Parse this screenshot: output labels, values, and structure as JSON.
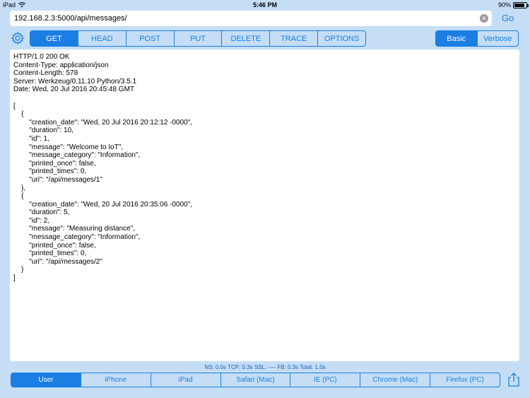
{
  "status_bar": {
    "device": "iPad",
    "time": "5:46 PM",
    "battery": "90%",
    "battery_level": 0.9
  },
  "url_bar": {
    "value": "192.168.2.3:5000/api/messages/",
    "go_label": "Go"
  },
  "methods": [
    "GET",
    "HEAD",
    "POST",
    "PUT",
    "DELETE",
    "TRACE",
    "OPTIONS"
  ],
  "selected_method": "GET",
  "modes": [
    "Basic",
    "Verbose"
  ],
  "selected_mode": "Basic",
  "response": {
    "headers": [
      "HTTP/1.0 200 OK",
      "Content-Type: application/json",
      "Content-Length: 578",
      "Server: Werkzeug/0.11.10 Python/3.5.1",
      "Date: Wed, 20 Jul 2016 20:45:48 GMT"
    ],
    "body_lines": [
      "[",
      "    {",
      "        \"creation_date\": \"Wed, 20 Jul 2016 20:12:12 -0000\",",
      "        \"duration\": 10,",
      "        \"id\": 1,",
      "        \"message\": \"Welcome to IoT\",",
      "        \"message_category\": \"Information\",",
      "        \"printed_once\": false,",
      "        \"printed_times\": 0,",
      "        \"uri\": \"/api/messages/1\"",
      "    },",
      "    {",
      "        \"creation_date\": \"Wed, 20 Jul 2016 20:35:06 -0000\",",
      "        \"duration\": 5,",
      "        \"id\": 2,",
      "        \"message\": \"Measuring distance\",",
      "        \"message_category\": \"Information\",",
      "        \"printed_once\": false,",
      "        \"printed_times\": 0,",
      "        \"uri\": \"/api/messages/2\"",
      "    }",
      "]"
    ]
  },
  "timings": "NS: 0.0s   TCP: 0.3s   SSL: ----   FB: 0.3s   Total: 1.0s",
  "user_agents": [
    "User",
    "iPhone",
    "iPad",
    "Safari (Mac)",
    "IE (PC)",
    "Chrome (Mac)",
    "Firefox (PC)"
  ],
  "selected_user_agent": "User",
  "colors": {
    "accent": "#1a7ee3",
    "background": "#c5def6"
  },
  "icons": {
    "settings": "gear-icon",
    "share": "share-icon",
    "clear": "clear-icon",
    "wifi": "wifi-icon",
    "battery": "battery-icon"
  }
}
